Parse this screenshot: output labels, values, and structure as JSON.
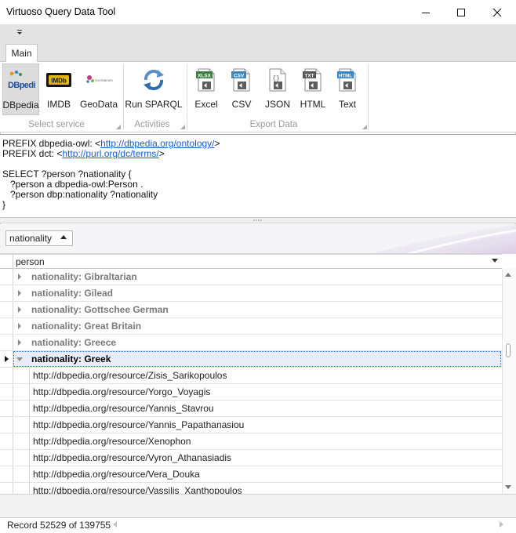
{
  "window": {
    "title": "Virtuoso Query Data Tool"
  },
  "ribbon": {
    "tabs": [
      {
        "label": "Main"
      }
    ],
    "buttons": {
      "dbpedia": "DBpedia",
      "imdb": "IMDB",
      "geodata": "GeoData",
      "run_sparql": "Run SPARQL",
      "excel": "Excel",
      "csv": "CSV",
      "json": "JSON",
      "html": "HTML",
      "text": "Text"
    },
    "icon_texts": {
      "dbpedia_logo": "DBpedia",
      "imdb_logo": "IMDb",
      "geodata_logo": "GeoNames",
      "xlsx": "XLSX",
      "csv": "CSV",
      "json": "{}",
      "txt": "TXT",
      "html": "HTML"
    },
    "groups": {
      "select_service": "Select service",
      "activities": "Activities",
      "export_data": "Export Data"
    }
  },
  "query": {
    "line1_prefix": "PREFIX dbpedia-owl: <",
    "line1_link": "http://dbpedia.org/ontology/",
    "line1_suffix": ">",
    "line2_prefix": "PREFIX dct: <",
    "line2_link": "http://purl.org/dc/terms/",
    "line2_suffix": ">",
    "line3": "",
    "line4": "SELECT ?person ?nationality {",
    "line5": "   ?person a dbpedia-owl:Person .",
    "line6": "   ?person dbp:nationality ?nationality",
    "line7": "}"
  },
  "group_panel": {
    "chip_label": "nationality"
  },
  "grid": {
    "column_header": "person",
    "group_rows": [
      {
        "label": "nationality: Gibraltarian",
        "expanded": false
      },
      {
        "label": "nationality: Gilead",
        "expanded": false
      },
      {
        "label": "nationality: Gottschee German",
        "expanded": false
      },
      {
        "label": "nationality: Great Britain",
        "expanded": false
      },
      {
        "label": "nationality: Greece",
        "expanded": false
      },
      {
        "label": "nationality: Greek",
        "expanded": true,
        "selected": true
      }
    ],
    "data_rows": [
      "http://dbpedia.org/resource/Zisis_Sarikopoulos",
      "http://dbpedia.org/resource/Yorgo_Voyagis",
      "http://dbpedia.org/resource/Yannis_Stavrou",
      "http://dbpedia.org/resource/Yannis_Papathanasiou",
      "http://dbpedia.org/resource/Xenophon",
      "http://dbpedia.org/resource/Vyron_Athanasiadis",
      "http://dbpedia.org/resource/Vera_Douka",
      "http://dbpedia.org/resource/Vassilis_Xanthopoulos"
    ]
  },
  "status": {
    "record_text": "Record 52529 of 139755"
  },
  "colors": {
    "link": "#1a5dc9",
    "selected_row": "#e6ebf7",
    "group_text": "#7a7a7a",
    "ribbon_bg": "#e3e3e3"
  }
}
